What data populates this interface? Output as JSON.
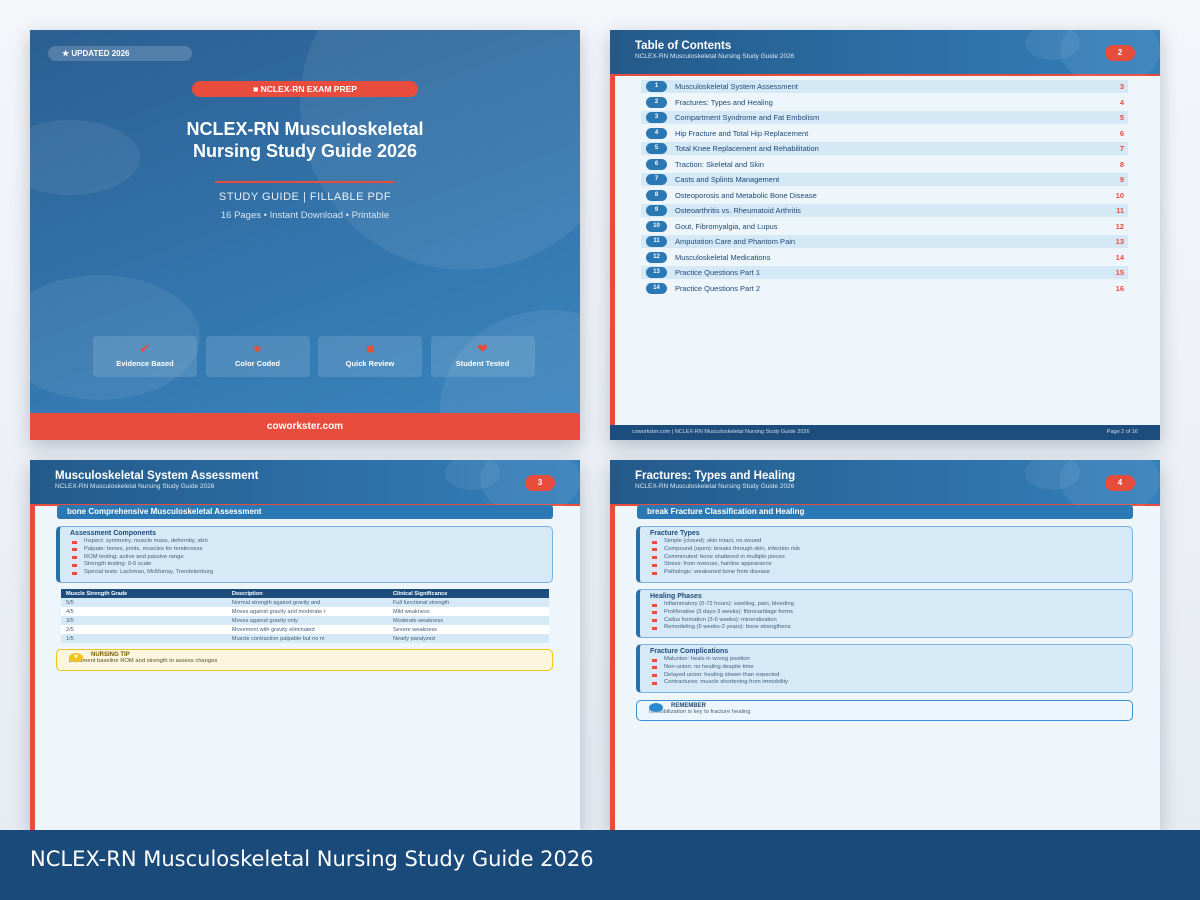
{
  "cover": {
    "badge": "★ UPDATED 2026",
    "pill": "■ NCLEX-RN EXAM PREP",
    "title_line1": "NCLEX-RN Musculoskeletal",
    "title_line2": "Nursing Study Guide 2026",
    "subtitle": "STUDY GUIDE  |  FILLABLE PDF",
    "meta": "16 Pages  •  Instant Download  •  Printable",
    "features": [
      {
        "icon": "✔",
        "icon_name": "check-icon",
        "label": "Evidence Based"
      },
      {
        "icon": "★",
        "icon_name": "star-icon",
        "label": "Color Coded"
      },
      {
        "icon": "■",
        "icon_name": "square-icon",
        "label": "Quick Review"
      },
      {
        "icon": "❤",
        "icon_name": "heart-icon",
        "label": "Student Tested"
      }
    ],
    "footer": "coworkster.com"
  },
  "toc": {
    "title": "Table of Contents",
    "subtitle": "NCLEX-RN Musculoskeletal Nursing Study Guide 2026",
    "page_num": "2",
    "items": [
      {
        "n": "1",
        "label": "Musculoskeletal System Assessment",
        "page": "3"
      },
      {
        "n": "2",
        "label": "Fractures: Types and Healing",
        "page": "4"
      },
      {
        "n": "3",
        "label": "Compartment Syndrome and Fat Embolism",
        "page": "5"
      },
      {
        "n": "4",
        "label": "Hip Fracture and Total Hip Replacement",
        "page": "6"
      },
      {
        "n": "5",
        "label": "Total Knee Replacement and Rehabilitation",
        "page": "7"
      },
      {
        "n": "6",
        "label": "Traction: Skeletal and Skin",
        "page": "8"
      },
      {
        "n": "7",
        "label": "Casts and Splints Management",
        "page": "9"
      },
      {
        "n": "8",
        "label": "Osteoporosis and Metabolic Bone Disease",
        "page": "10"
      },
      {
        "n": "9",
        "label": "Osteoarthritis vs. Rheumatoid Arthritis",
        "page": "11"
      },
      {
        "n": "10",
        "label": "Gout, Fibromyalgia, and Lupus",
        "page": "12"
      },
      {
        "n": "11",
        "label": "Amputation Care and Phantom Pain",
        "page": "13"
      },
      {
        "n": "12",
        "label": "Musculoskeletal Medications",
        "page": "14"
      },
      {
        "n": "13",
        "label": "Practice Questions Part 1",
        "page": "15"
      },
      {
        "n": "14",
        "label": "Practice Questions Part 2",
        "page": "16"
      }
    ],
    "footer_left": "coworkster.com  |  NCLEX-RN Musculoskeletal Nursing Study Guide 2026",
    "footer_right": "Page 2 of 16"
  },
  "page3": {
    "title": "Musculoskeletal System Assessment",
    "subtitle": "NCLEX-RN Musculoskeletal Nursing Study Guide 2026",
    "page_num": "3",
    "section": "bone  Comprehensive Musculoskeletal Assessment",
    "box": {
      "heading": "Assessment Components",
      "items": [
        "Inspect: symmetry, muscle mass, deformity, skin",
        "Palpate: bones, joints, muscles for tenderness",
        "ROM testing: active and passive range",
        "Strength testing: 0-5 scale",
        "Special tests: Lachman, McMurray, Trendelenburg"
      ]
    },
    "table": {
      "headers": [
        "Muscle Strength Grade",
        "Description",
        "Clinical Significance"
      ],
      "rows": [
        [
          "5/5",
          "Normal strength against gravity and",
          "Full functional strength"
        ],
        [
          "4/5",
          "Moves against gravity and moderate r",
          "Mild weakness"
        ],
        [
          "3/5",
          "Moves against gravity only",
          "Moderate weakness"
        ],
        [
          "2/5",
          "Movement with gravity eliminated",
          "Severe weakness"
        ],
        [
          "1/5",
          "Muscle contraction palpable but no m",
          "Nearly paralyzed"
        ]
      ]
    },
    "tip": {
      "title": "NURSING TIP",
      "text": "Document baseline ROM and strength to assess changes"
    }
  },
  "page4": {
    "title": "Fractures: Types and Healing",
    "subtitle": "NCLEX-RN Musculoskeletal Nursing Study Guide 2026",
    "page_num": "4",
    "section": "break  Fracture Classification and Healing",
    "boxes": [
      {
        "heading": "Fracture Types",
        "items": [
          "Simple (closed): skin intact, no wound",
          "Compound (open): breaks through skin, infection risk",
          "Comminuted: bone shattered in multiple pieces",
          "Stress: from overuse, hairline appearance",
          "Pathologic: weakened bone from disease"
        ]
      },
      {
        "heading": "Healing Phases",
        "items": [
          "Inflammatory (0-72 hours): swelling, pain, bleeding",
          "Proliferative (3 days-3 weeks): fibrocartilage forms",
          "Callus formation (3-6 weeks): mineralization",
          "Remodeling (6 weeks-2 years): bone strengthens"
        ]
      },
      {
        "heading": "Fracture Complications",
        "items": [
          "Malunion: heals in wrong position",
          "Non-union: no healing despite time",
          "Delayed union: healing slower than expected",
          "Contractures: muscle shortening from immobility"
        ]
      }
    ],
    "remember": {
      "title": "REMEMBER",
      "text": "Immobilization is key to fracture healing"
    }
  },
  "caption": "NCLEX-RN Musculoskeletal Nursing Study Guide 2026",
  "colors": {
    "accent": "#e84c3d",
    "primary": "#2a78b4",
    "dark": "#1a4a7a"
  }
}
